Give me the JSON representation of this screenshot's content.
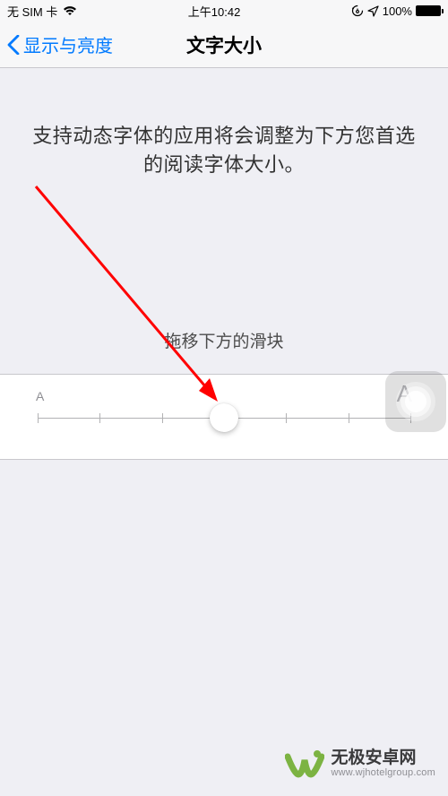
{
  "status_bar": {
    "carrier": "无 SIM 卡",
    "time": "上午10:42",
    "battery_text": "100%"
  },
  "nav": {
    "back_label": "显示与亮度",
    "title": "文字大小"
  },
  "content": {
    "description": "支持动态字体的应用将会调整为下方您首选的阅读字体大小。",
    "slider_instruction": "拖移下方的滑块",
    "slider": {
      "min_label": "A",
      "max_label": "A",
      "tick_count": 7,
      "thumb_position_index": 3
    }
  },
  "watermark": {
    "title": "无极安卓网",
    "url": "www.wjhotelgroup.com"
  }
}
